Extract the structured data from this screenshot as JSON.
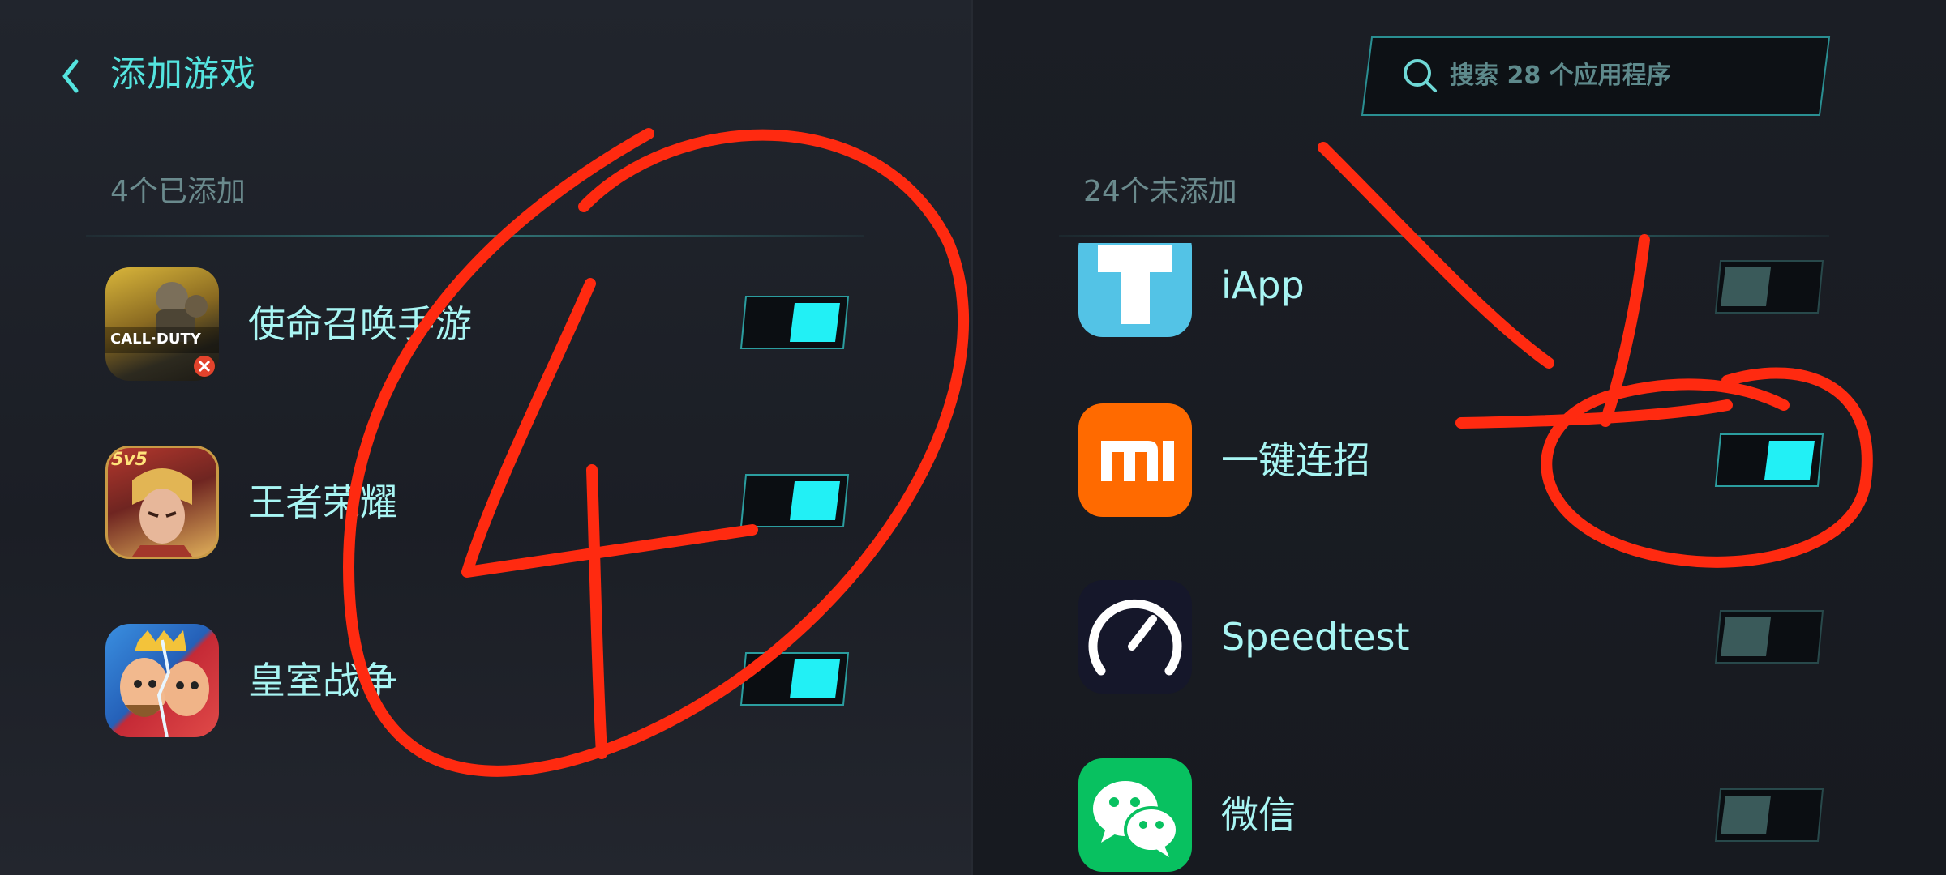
{
  "header": {
    "title": "添加游戏",
    "back_icon": "chevron-left-icon"
  },
  "added": {
    "label": "4个已添加",
    "items": [
      {
        "name": "使命召唤手游",
        "enabled": true,
        "icon": "call-of-duty-icon",
        "icon_text": "CALL·DUTY"
      },
      {
        "name": "王者荣耀",
        "enabled": true,
        "icon": "honor-of-kings-icon",
        "icon_text": "5v5"
      },
      {
        "name": "皇室战争",
        "enabled": true,
        "icon": "clash-royale-icon"
      }
    ]
  },
  "not_added": {
    "label": "24个未添加",
    "items": [
      {
        "name": "iApp",
        "enabled": false,
        "icon": "iapp-icon"
      },
      {
        "name": "一键连招",
        "enabled": true,
        "icon": "mi-logo-icon"
      },
      {
        "name": "Speedtest",
        "enabled": false,
        "icon": "speedometer-icon"
      },
      {
        "name": "微信",
        "enabled": false,
        "icon": "wechat-icon"
      }
    ]
  },
  "search": {
    "placeholder": "搜索 28 个应用程序",
    "icon": "search-icon"
  },
  "colors": {
    "accent": "#54e4df",
    "toggle_on": "#22f0f5",
    "toggle_off": "#3a5a5a",
    "annotation": "#ff2a10"
  }
}
